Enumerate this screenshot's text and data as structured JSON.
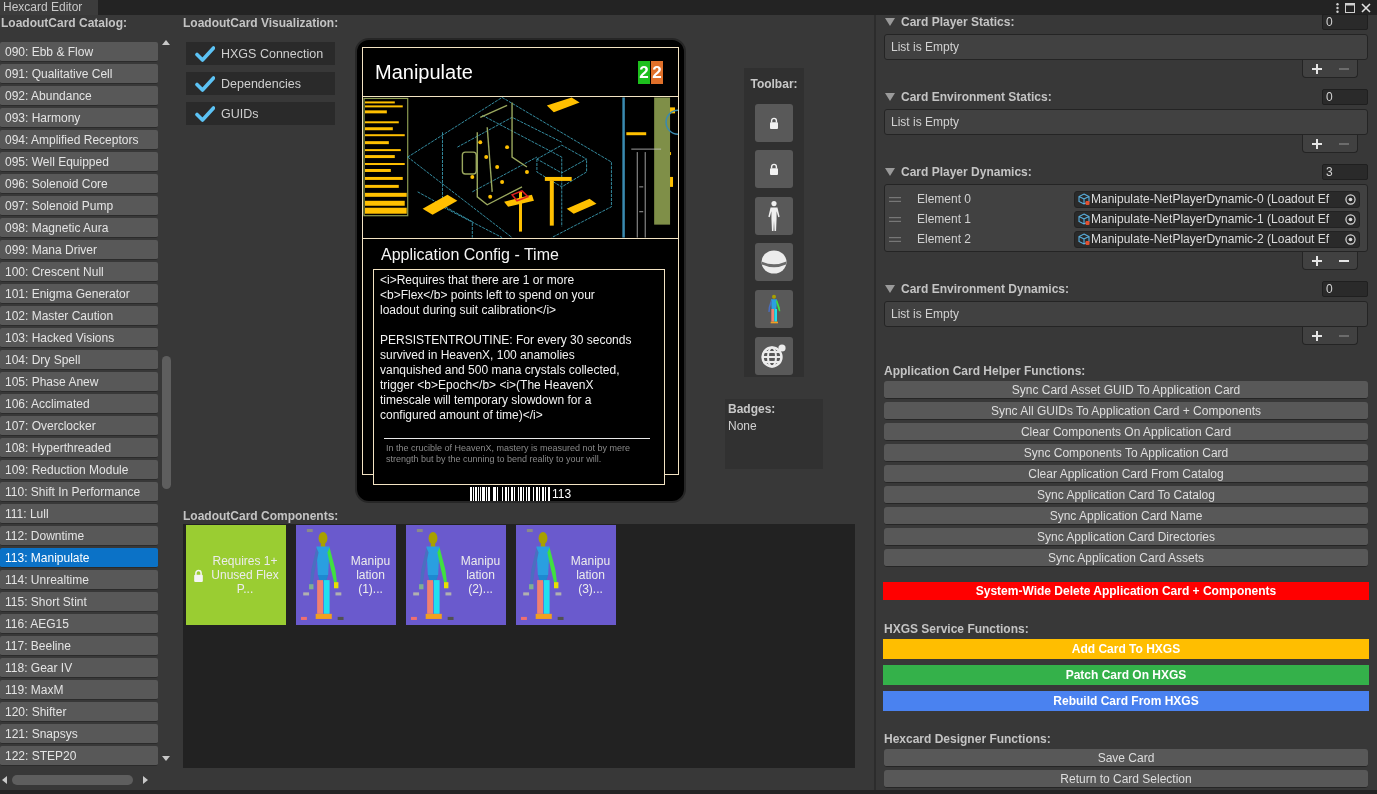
{
  "window": {
    "tab": "Hexcard Editor"
  },
  "catalog": {
    "title": "LoadoutCard Catalog:",
    "items": [
      {
        "label": "090: Ebb & Flow",
        "selected": false
      },
      {
        "label": "091: Qualitative Cell",
        "selected": false
      },
      {
        "label": "092: Abundance",
        "selected": false
      },
      {
        "label": "093: Harmony",
        "selected": false
      },
      {
        "label": "094: Amplified Receptors",
        "selected": false
      },
      {
        "label": "095: Well Equipped",
        "selected": false
      },
      {
        "label": "096: Solenoid Core",
        "selected": false
      },
      {
        "label": "097: Solenoid Pump",
        "selected": false
      },
      {
        "label": "098: Magnetic Aura",
        "selected": false
      },
      {
        "label": "099: Mana Driver",
        "selected": false
      },
      {
        "label": "100: Crescent Null",
        "selected": false
      },
      {
        "label": "101: Enigma Generator",
        "selected": false
      },
      {
        "label": "102: Master Caution",
        "selected": false
      },
      {
        "label": "103: Hacked Visions",
        "selected": false
      },
      {
        "label": "104: Dry Spell",
        "selected": false
      },
      {
        "label": "105: Phase Anew",
        "selected": false
      },
      {
        "label": "106: Acclimated",
        "selected": false
      },
      {
        "label": "107: Overclocker",
        "selected": false
      },
      {
        "label": "108: Hyperthreaded",
        "selected": false
      },
      {
        "label": "109: Reduction Module",
        "selected": false
      },
      {
        "label": "110: Shift In Performance",
        "selected": false
      },
      {
        "label": "111: Lull",
        "selected": false
      },
      {
        "label": "112: Downtime",
        "selected": false
      },
      {
        "label": "113: Manipulate",
        "selected": true
      },
      {
        "label": "114: Unrealtime",
        "selected": false
      },
      {
        "label": "115: Short Stint",
        "selected": false
      },
      {
        "label": "116: AEG15",
        "selected": false
      },
      {
        "label": "117: Beeline",
        "selected": false
      },
      {
        "label": "118: Gear IV",
        "selected": false
      },
      {
        "label": "119: MaxM",
        "selected": false
      },
      {
        "label": "120: Shifter",
        "selected": false
      },
      {
        "label": "121: Snapsys",
        "selected": false
      },
      {
        "label": "122: STEP20",
        "selected": false
      }
    ]
  },
  "visualization": {
    "title": "LoadoutCard Visualization:",
    "toggles": [
      {
        "label": "HXGS Connection",
        "checked": true
      },
      {
        "label": "Dependencies",
        "checked": true
      },
      {
        "label": "GUIDs",
        "checked": true
      }
    ]
  },
  "card": {
    "name": "Manipulate",
    "cost_badges": [
      {
        "value": "2",
        "color": "#1dbf1d"
      },
      {
        "value": "2",
        "color": "#e0702a"
      }
    ],
    "subtitle": "Application Config - Time",
    "description": [
      "<i>Requires that there are 1 or more <b>Flex</b> points left to spend on your loadout during suit calibration</i>",
      "PERSISTENTROUTINE: For every 30 seconds survived in HeavenX, 100 anamolies vanquished and 500 mana crystals collected, trigger <b>Epoch</b> <i>(The HeavenX timescale will temporary slowdown for a configured amount of time)</i>"
    ],
    "flavor": "In the crucible of HeavenX, mastery is measured not by mere strength but by the cunning to bend reality to your will.",
    "number": "113"
  },
  "toolbar": {
    "title": "Toolbar:"
  },
  "badges": {
    "title": "Badges:",
    "value": "None"
  },
  "components": {
    "title": "LoadoutCard Components:",
    "tiles": [
      {
        "kind": "requirement",
        "label": "Requires 1+\nUnused Flex\nP...",
        "color": "#9acd32"
      },
      {
        "kind": "effect",
        "label": "Manipu\nlation\n(1)...",
        "color": "#6a5acd"
      },
      {
        "kind": "effect",
        "label": "Manipu\nlation\n(2)...",
        "color": "#6a5acd"
      },
      {
        "kind": "effect",
        "label": "Manipu\nlation\n(3)...",
        "color": "#6a5acd"
      }
    ]
  },
  "lists": [
    {
      "title": "Card Player Statics:",
      "expanded": true,
      "count": "0",
      "empty_text": "List is Empty",
      "remove_enabled": false
    },
    {
      "title": "Card Environment Statics:",
      "expanded": true,
      "count": "0",
      "empty_text": "List is Empty",
      "remove_enabled": false
    },
    {
      "title": "Card Player Dynamics:",
      "expanded": true,
      "count": "3",
      "elements": [
        {
          "label": "Element 0",
          "value": "Manipulate-NetPlayerDynamic-0 (Loadout Ef"
        },
        {
          "label": "Element 1",
          "value": "Manipulate-NetPlayerDynamic-1 (Loadout Ef"
        },
        {
          "label": "Element 2",
          "value": "Manipulate-NetPlayerDynamic-2 (Loadout Ef"
        }
      ],
      "remove_enabled": true
    },
    {
      "title": "Card Environment Dynamics:",
      "expanded": true,
      "count": "0",
      "empty_text": "List is Empty",
      "remove_enabled": false
    }
  ],
  "helper_functions": {
    "title": "Application Card Helper Functions:",
    "buttons": [
      "Sync Card Asset GUID To Application Card",
      "Sync All GUIDs To Application Card + Components",
      "Clear Components On Application Card",
      "Sync Components To Application Card",
      "Clear Application Card From Catalog",
      "Sync Application Card To Catalog",
      "Sync Application Card Name",
      "Sync Application Card Directories",
      "Sync Application Card Assets"
    ],
    "delete_button": "System-Wide Delete Application Card + Components"
  },
  "hxgs": {
    "title": "HXGS Service Functions:",
    "buttons": [
      {
        "label": "Add Card To HXGS",
        "color": "#ffbe00"
      },
      {
        "label": "Patch Card On HXGS",
        "color": "#34b14a"
      },
      {
        "label": "Rebuild Card From HXGS",
        "color": "#4a82f0"
      }
    ]
  },
  "designer": {
    "title": "Hexcard Designer Functions:",
    "buttons": [
      "Save Card",
      "Return to Card Selection"
    ]
  }
}
